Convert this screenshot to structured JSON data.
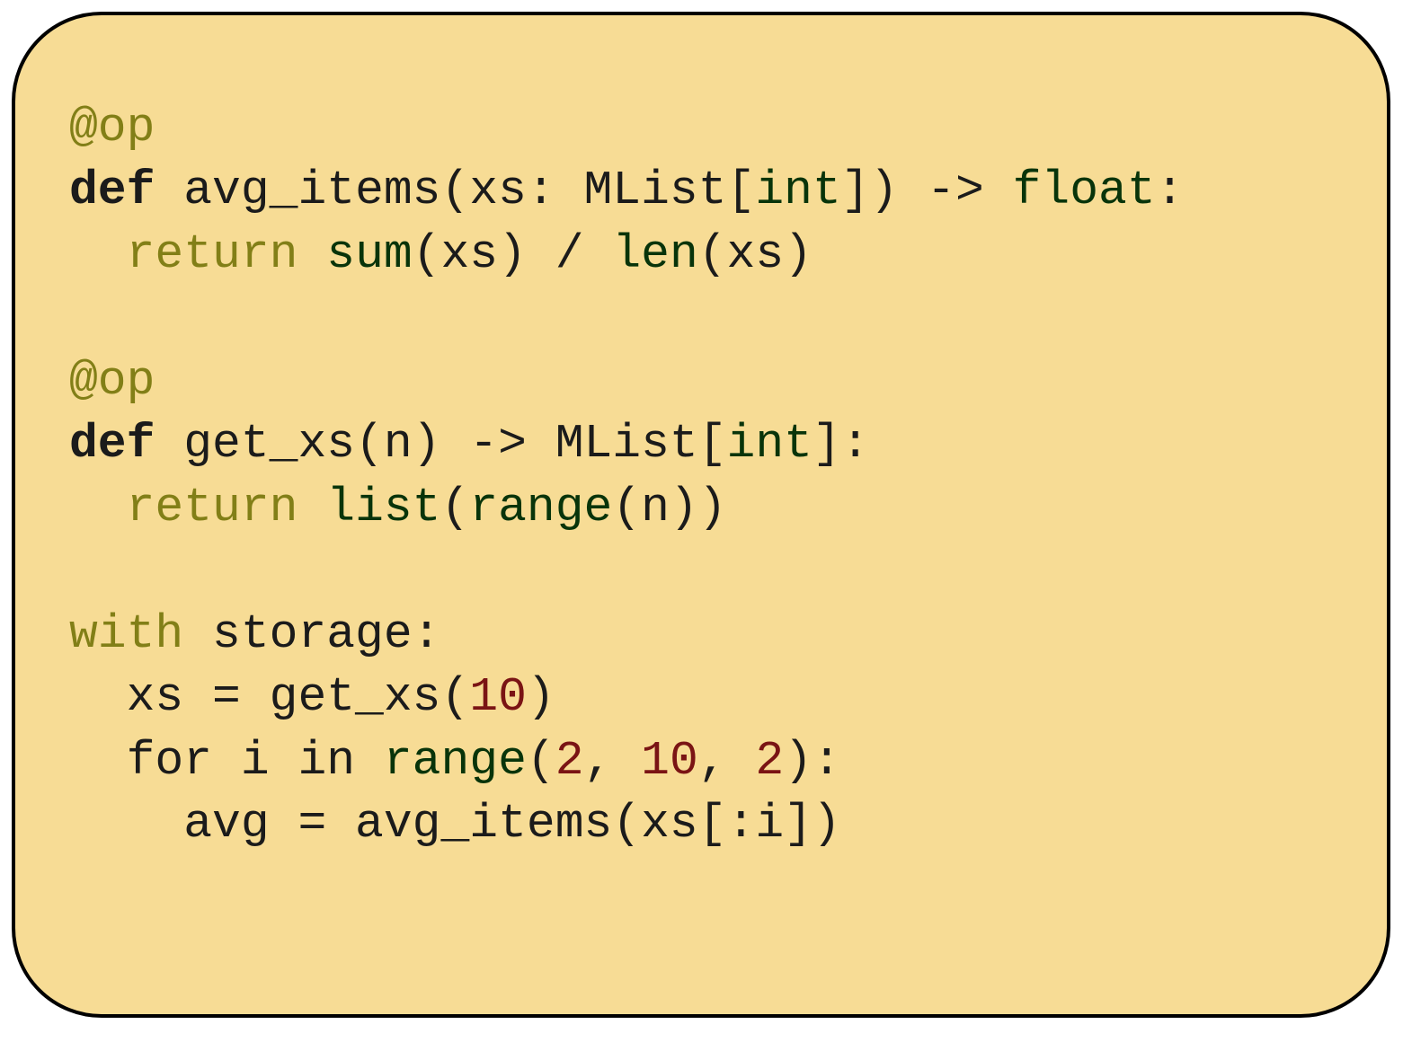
{
  "code": {
    "l01_dec": "@op",
    "l02_def": "def ",
    "l02_name": "avg_items(xs: MList[",
    "l02_int": "int",
    "l02_tail": "]) -> ",
    "l02_float": "float",
    "l02_colon": ":",
    "l03_indent": "  ",
    "l03_return": "return ",
    "l03_sum": "sum",
    "l03_mid": "(xs) / ",
    "l03_len": "len",
    "l03_tail": "(xs)",
    "l05_dec": "@op",
    "l06_def": "def ",
    "l06_name": "get_xs(n) -> MList[",
    "l06_int": "int",
    "l06_tail": "]:",
    "l07_indent": "  ",
    "l07_return": "return ",
    "l07_list": "list",
    "l07_open": "(",
    "l07_range": "range",
    "l07_tail": "(n))",
    "l09_with": "with ",
    "l09_storage": "storage:",
    "l10_body": "  xs = get_xs(",
    "l10_num": "10",
    "l10_close": ")",
    "l11_a": "  for i in ",
    "l11_range": "range",
    "l11_open": "(",
    "l11_n1": "2",
    "l11_c1": ", ",
    "l11_n2": "10",
    "l11_c2": ", ",
    "l11_n3": "2",
    "l11_close": "):",
    "l12_body": "    avg = avg_items(xs[:i])"
  }
}
